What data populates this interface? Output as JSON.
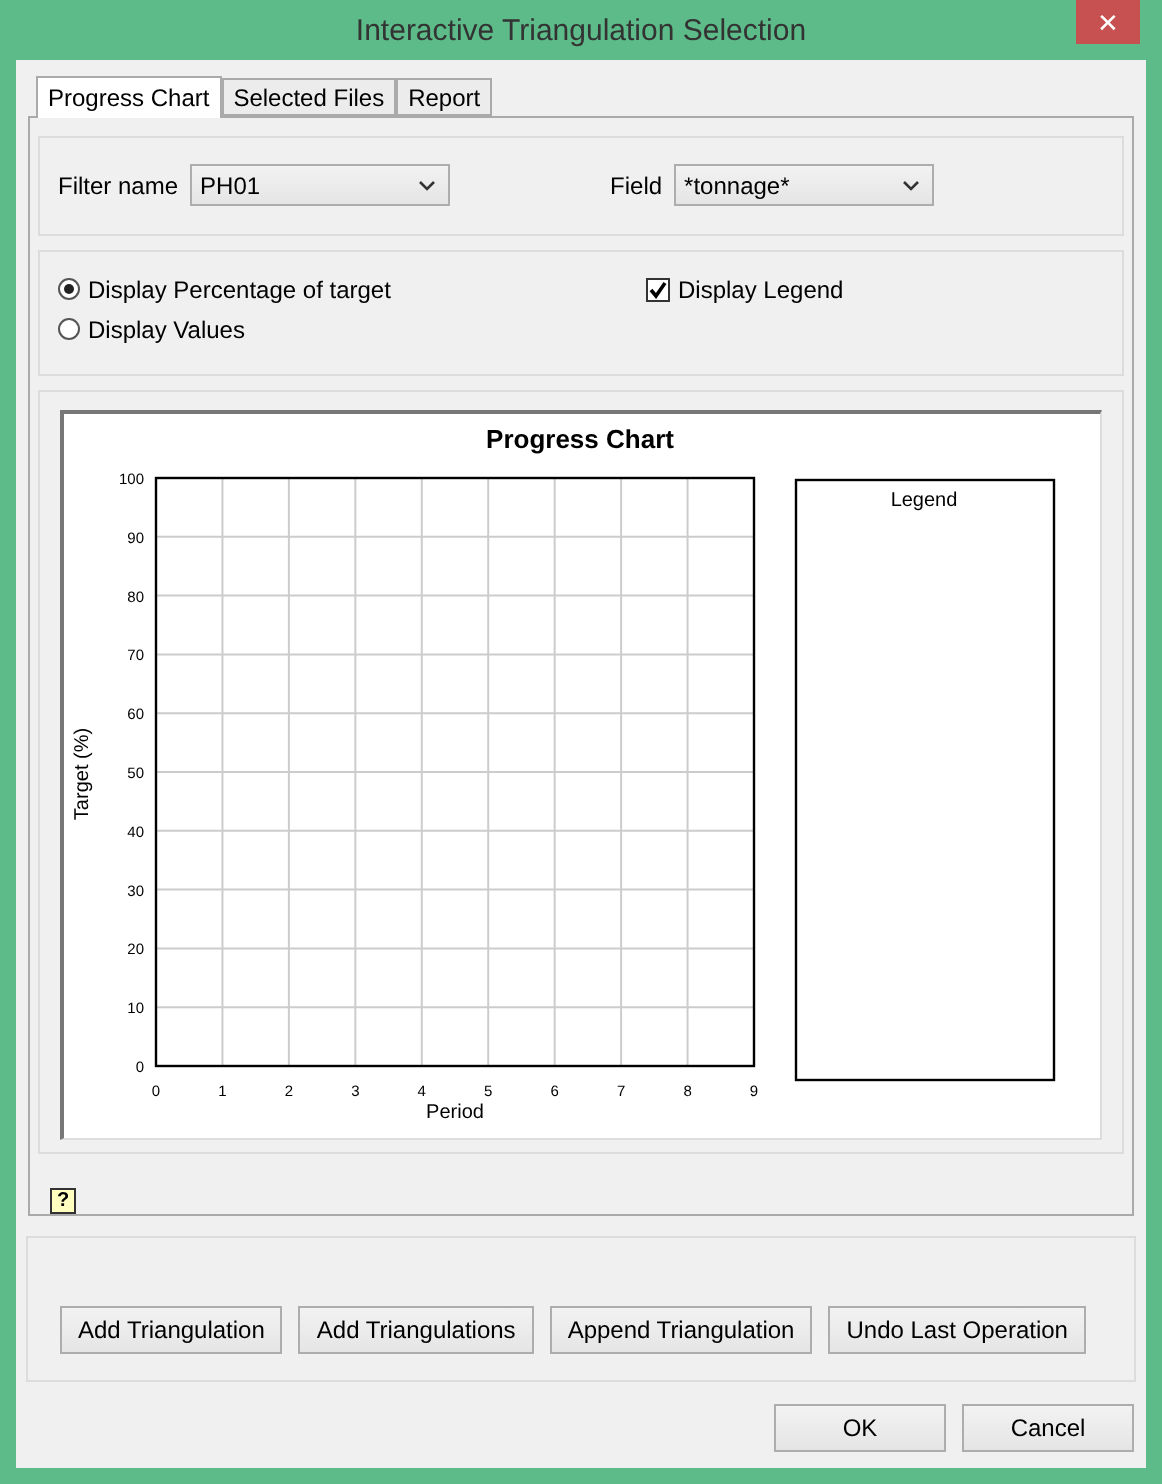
{
  "window": {
    "title": "Interactive Triangulation Selection",
    "close": "✕"
  },
  "tabs": [
    {
      "label": "Progress Chart",
      "selected": true
    },
    {
      "label": "Selected Files",
      "selected": false
    },
    {
      "label": "Report",
      "selected": false
    }
  ],
  "filters": [
    {
      "label": "Filter name",
      "value": "PH01"
    },
    {
      "label": "Field",
      "value": "*tonnage*"
    }
  ],
  "display_mode": [
    {
      "label": "Display Percentage of target",
      "selected": true
    },
    {
      "label": "Display Values",
      "selected": false
    }
  ],
  "display_legend": {
    "label": "Display Legend",
    "checked": true
  },
  "chart": {
    "legend_title": "Legend",
    "chart_data": {
      "type": "line",
      "grid": true,
      "title": "Progress Chart",
      "xlabel": "Period",
      "ylabel": "Target (%)",
      "xlim": [
        0,
        9
      ],
      "ylim": [
        0,
        100
      ],
      "xticks": [
        0,
        1,
        2,
        3,
        4,
        5,
        6,
        7,
        8,
        9
      ],
      "yticks": [
        0,
        10,
        20,
        30,
        40,
        50,
        60,
        70,
        80,
        90,
        100
      ]
    }
  },
  "help": "?",
  "actions": [
    "Add Triangulation",
    "Add Triangulations",
    "Append Triangulation",
    "Undo Last Operation"
  ],
  "buttons": [
    "OK",
    "Cancel"
  ]
}
